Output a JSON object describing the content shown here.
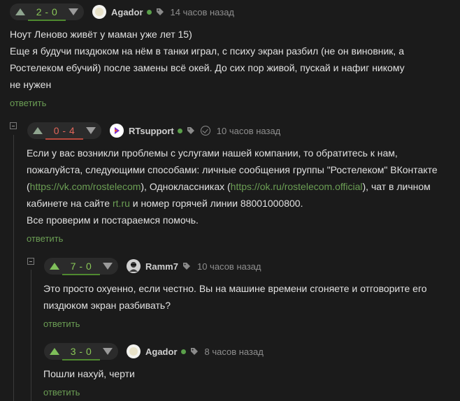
{
  "comments": [
    {
      "rating": "2 - 0",
      "author": "Agador",
      "time": "14 часов назад",
      "lines": [
        "Ноут Леново живёт у маман уже лет 15)",
        "Еще я будучи пиздюком на нём в танки играл, с психу экран разбил (не он виновник, а",
        "Ростелеком ебучий) после замены всё окей. До сих пор живой, пускай и нафиг никому",
        "не нужен"
      ],
      "reply": "ответить"
    },
    {
      "rating": "0 - 4",
      "author": "RTsupport",
      "time": "10 часов назад",
      "line1": "Если у вас возникли проблемы с услугами нашей компании, то обратитесь к нам,",
      "line2": "пожалуйста, следующими способами: личные сообщения группы \"Ростелеком\" ВКонтакте",
      "line3_a": "(",
      "link_vk": "https://vk.com/rostelecom",
      "line3_b": "), Одноклассниках (",
      "link_ok": "https://ok.ru/rostelecom.official",
      "line3_c": "), чат в личном",
      "line4_a": "кабинете на сайте ",
      "link_rt": "rt.ru",
      "line4_b": " и номер горячей линии 88001000800.",
      "line5": "Все проверим и постараемся помочь.",
      "reply": "ответить"
    },
    {
      "rating": "7 - 0",
      "author": "Ramm7",
      "time": "10 часов назад",
      "lines": [
        "Это просто охуенно, если честно. Вы на машине времени сгоняете и отговорите его",
        "пиздюком экран разбивать?"
      ],
      "reply": "ответить"
    },
    {
      "rating": "3 - 0",
      "author": "Agador",
      "time": "8 часов назад",
      "lines": [
        "Пошли нахуй, черти"
      ],
      "reply": "ответить"
    }
  ],
  "colors": {
    "accent_green": "#6b9e54",
    "rating_red": "#e0665a",
    "online": "#5aa04a"
  },
  "icons": [
    "tag-icon",
    "verified-check-icon",
    "collapse-icon",
    "upvote-icon",
    "downvote-icon"
  ]
}
